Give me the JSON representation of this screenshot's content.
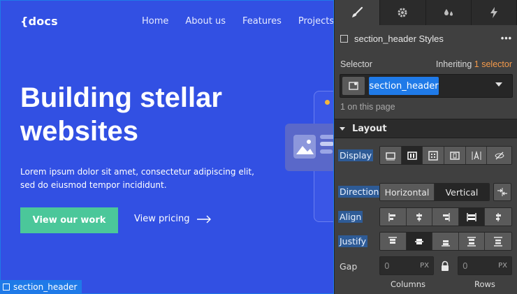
{
  "site": {
    "logo": "{docs",
    "nav": [
      "Home",
      "About us",
      "Features",
      "Projects"
    ],
    "hero_title": "Building stellar websites",
    "hero_subtitle": "Lorem ipsum dolor sit amet, consectetur adipiscing elit, sed do eiusmod tempor incididunt.",
    "primary_button": "View our work",
    "secondary_link": "View pricing",
    "selected_element_tag": "section_header"
  },
  "panel": {
    "tabs": [
      "paintbrush-icon",
      "gear-icon",
      "drops-icon",
      "lightning-icon"
    ],
    "styles_title": "section_header Styles",
    "more_label": "•••",
    "selector_label": "Selector",
    "inheriting_prefix": "Inheriting",
    "inheriting_count": "1 selector",
    "selector_token": "section_header",
    "on_page": "1 on this page",
    "section_title": "Layout",
    "display_label": "Display",
    "display_options": [
      "block-icon",
      "flex-icon",
      "grid-icon",
      "inline-block-icon",
      "inline-text-icon",
      "none-icon"
    ],
    "display_selected": 1,
    "direction_label": "Direction",
    "direction_options": [
      "Horizontal",
      "Vertical"
    ],
    "direction_selected": 1,
    "align_label": "Align",
    "align_options": [
      "align-start-icon",
      "align-center-icon",
      "align-end-icon",
      "align-stretch-icon",
      "align-baseline-icon"
    ],
    "align_selected": 3,
    "justify_label": "Justify",
    "justify_options": [
      "justify-start-icon",
      "justify-center-icon",
      "justify-end-icon",
      "justify-space-between-icon",
      "justify-space-around-icon"
    ],
    "justify_selected": 1,
    "gap_label": "Gap",
    "gap_columns_value": "0",
    "gap_rows_value": "0",
    "gap_unit": "PX",
    "columns_label": "Columns",
    "rows_label": "Rows"
  },
  "colors": {
    "canvas_bg": "#3250e3",
    "primary_button": "#4bc79a",
    "accent_blue": "#1f7ae8",
    "accent_orange": "#f59a4a",
    "panel_bg": "#404040"
  }
}
